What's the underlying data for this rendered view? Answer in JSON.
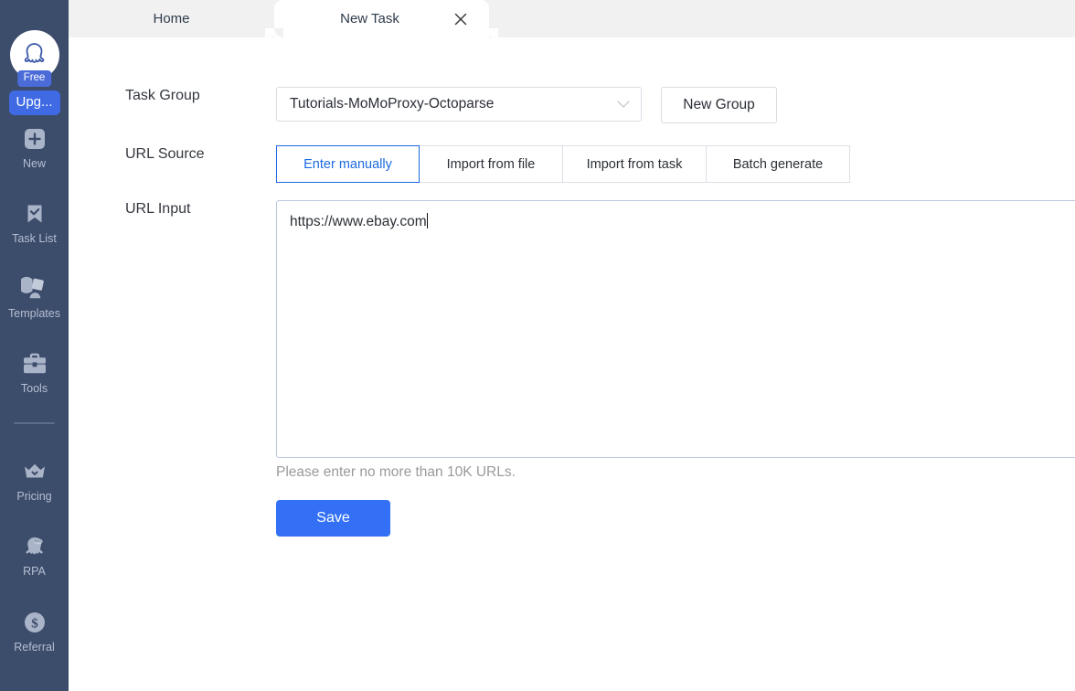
{
  "sidebar": {
    "logo_icon": "octopus-logo-icon",
    "plan_badge": "Free",
    "upgrade_label": "Upg...",
    "items": [
      {
        "label": "New",
        "icon": "plus-square-icon"
      },
      {
        "label": "Task List",
        "icon": "bookmark-check-icon"
      },
      {
        "label": "Templates",
        "icon": "templates-icon"
      },
      {
        "label": "Tools",
        "icon": "toolbox-icon"
      },
      {
        "label": "Pricing",
        "icon": "crown-icon"
      },
      {
        "label": "RPA",
        "icon": "rpa-octopus-icon"
      },
      {
        "label": "Referral",
        "icon": "dollar-circle-icon"
      }
    ]
  },
  "tabs": [
    {
      "label": "Home",
      "active": false,
      "closable": false
    },
    {
      "label": "New Task",
      "active": true,
      "closable": true
    }
  ],
  "tab_close_icon": "close-icon",
  "form": {
    "task_group": {
      "label": "Task Group",
      "value": "Tutorials-MoMoProxy-Octoparse",
      "dropdown_icon": "chevron-down-icon",
      "new_group_label": "New Group"
    },
    "url_source": {
      "label": "URL Source",
      "options": [
        {
          "label": "Enter manually",
          "active": true
        },
        {
          "label": "Import from file",
          "active": false
        },
        {
          "label": "Import from task",
          "active": false
        },
        {
          "label": "Batch generate",
          "active": false
        }
      ]
    },
    "url_input": {
      "label": "URL Input",
      "value": "https://www.ebay.com",
      "placeholder": ""
    },
    "hint": "Please enter no more than 10K URLs.",
    "save_label": "Save"
  },
  "colors": {
    "sidebar_bg": "#3c4c6b",
    "accent_blue": "#3370f5",
    "active_segment_blue": "#1a6ae0",
    "tabstrip_bg": "#f1f1f1"
  }
}
